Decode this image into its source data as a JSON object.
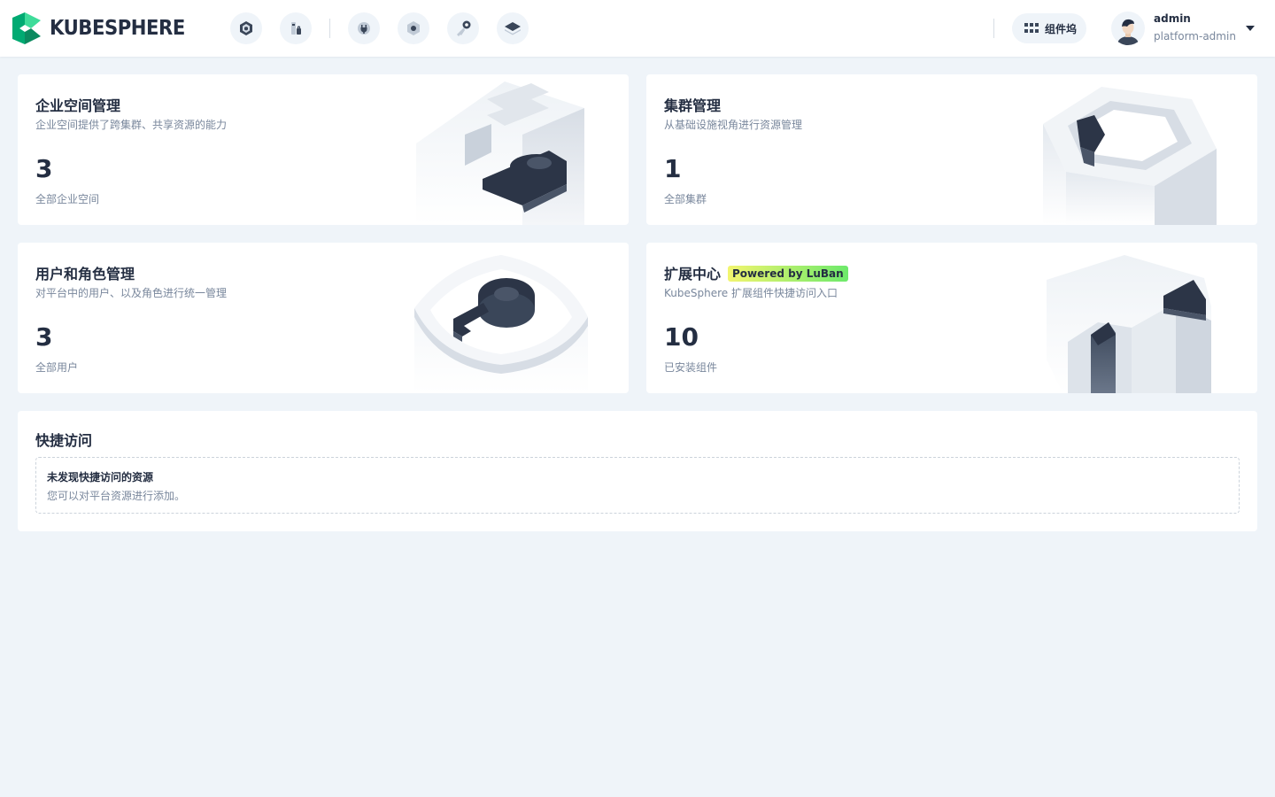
{
  "header": {
    "logo_text": "KUBESPHERE",
    "nav_icons": [
      "workspace-icon",
      "cluster-icon",
      "extension-icon",
      "settings-icon",
      "access-key-icon",
      "layers-icon"
    ],
    "dock_label": "组件坞",
    "user_name": "admin",
    "user_role": "platform-admin"
  },
  "cards": {
    "workspace": {
      "title": "企业空间管理",
      "desc": "企业空间提供了跨集群、共享资源的能力",
      "count": "3",
      "count_label": "全部企业空间"
    },
    "cluster": {
      "title": "集群管理",
      "desc": "从基础设施视角进行资源管理",
      "count": "1",
      "count_label": "全部集群"
    },
    "users": {
      "title": "用户和角色管理",
      "desc": "对平台中的用户、以及角色进行统一管理",
      "count": "3",
      "count_label": "全部用户"
    },
    "extensions": {
      "title": "扩展中心",
      "badge": "Powered by LuBan",
      "desc": "KubeSphere 扩展组件快捷访问入口",
      "count": "10",
      "count_label": "已安装组件"
    }
  },
  "quick_access": {
    "title": "快捷访问",
    "empty_title": "未发现快捷访问的资源",
    "empty_desc": "您可以对平台资源进行添加。"
  },
  "colors": {
    "brand_green": "#00aa72",
    "dark": "#242e42",
    "muted": "#79879c",
    "background": "#eff4f9"
  }
}
